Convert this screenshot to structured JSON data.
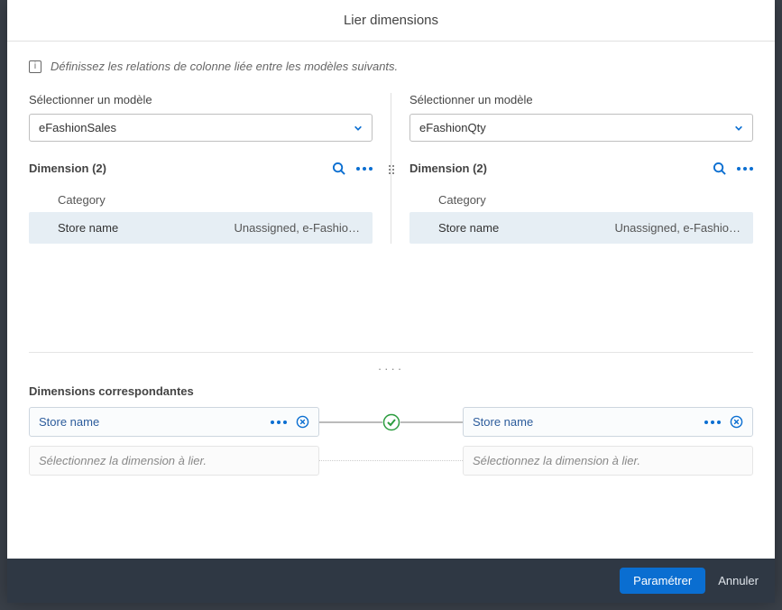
{
  "header": {
    "title": "Lier dimensions"
  },
  "info": {
    "text": "Définissez les relations de colonne liée entre les modèles suivants."
  },
  "leftPanel": {
    "selectLabel": "Sélectionner un modèle",
    "modelName": "eFashionSales",
    "dimTitle": "Dimension  (2)",
    "category": "Category",
    "dimRow": {
      "name": "Store name",
      "meta": "Unassigned, e-Fashio…"
    }
  },
  "rightPanel": {
    "selectLabel": "Sélectionner un modèle",
    "modelName": "eFashionQty",
    "dimTitle": "Dimension  (2)",
    "category": "Category",
    "dimRow": {
      "name": "Store name",
      "meta": "Unassigned, e-Fashio…"
    }
  },
  "match": {
    "title": "Dimensions correspondantes",
    "left": "Store name",
    "right": "Store name",
    "placeholder": "Sélectionnez la dimension à lier."
  },
  "footer": {
    "primary": "Paramétrer",
    "cancel": "Annuler"
  }
}
